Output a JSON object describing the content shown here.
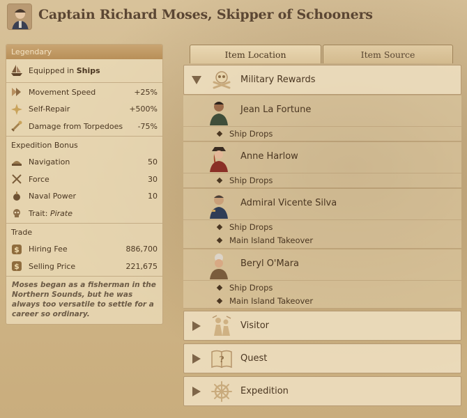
{
  "header": {
    "title": "Captain Richard Moses, Skipper of Schooners"
  },
  "left_panel": {
    "rarity": "Legendary",
    "equipped": {
      "prefix": "Equipped in",
      "target": "Ships",
      "icon": "ship-icon"
    },
    "stats": [
      {
        "label": "Movement Speed",
        "value": "+25%",
        "icon": "speed-icon"
      },
      {
        "label": "Self-Repair",
        "value": "+500%",
        "icon": "repair-sparkle-icon"
      },
      {
        "label": "Damage from Torpedoes",
        "value": "-75%",
        "icon": "torpedo-icon"
      }
    ],
    "expedition": {
      "title": "Expedition Bonus",
      "items": [
        {
          "label": "Navigation",
          "value": "50",
          "icon": "navigation-icon"
        },
        {
          "label": "Force",
          "value": "30",
          "icon": "force-icon"
        },
        {
          "label": "Naval Power",
          "value": "10",
          "icon": "naval-power-icon"
        }
      ],
      "trait_prefix": "Trait:",
      "trait_value": "Pirate",
      "trait_icon": "skull-icon"
    },
    "trade": {
      "title": "Trade",
      "items": [
        {
          "label": "Hiring Fee",
          "value": "886,700",
          "icon": "coin-icon"
        },
        {
          "label": "Selling Price",
          "value": "221,675",
          "icon": "coin-icon"
        }
      ]
    },
    "flavor": "Moses began as a fisherman in the Northern Sounds, but he was always too versatile to settle for a career so ordinary."
  },
  "tabs": [
    {
      "label": "Item Location"
    },
    {
      "label": "Item Source"
    }
  ],
  "sources": {
    "categories": [
      {
        "label": "Military Rewards",
        "icon": "skull-crossbones-icon",
        "expanded": true
      },
      {
        "label": "Visitor",
        "icon": "visitor-icon",
        "expanded": false
      },
      {
        "label": "Quest",
        "icon": "quest-book-icon",
        "expanded": false
      },
      {
        "label": "Expedition",
        "icon": "ship-wheel-icon",
        "expanded": false
      }
    ],
    "npcs": [
      {
        "name": "Jean La Fortune",
        "drops": [
          "Ship Drops"
        ]
      },
      {
        "name": "Anne Harlow",
        "drops": [
          "Ship Drops"
        ]
      },
      {
        "name": "Admiral Vicente Silva",
        "drops": [
          "Ship Drops",
          "Main Island Takeover"
        ]
      },
      {
        "name": "Beryl O'Mara",
        "drops": [
          "Ship Drops",
          "Main Island Takeover"
        ]
      }
    ]
  },
  "colors": {
    "text": "#4a3621",
    "rarity_header": "#b88f58",
    "panel": "#ecdcba"
  }
}
